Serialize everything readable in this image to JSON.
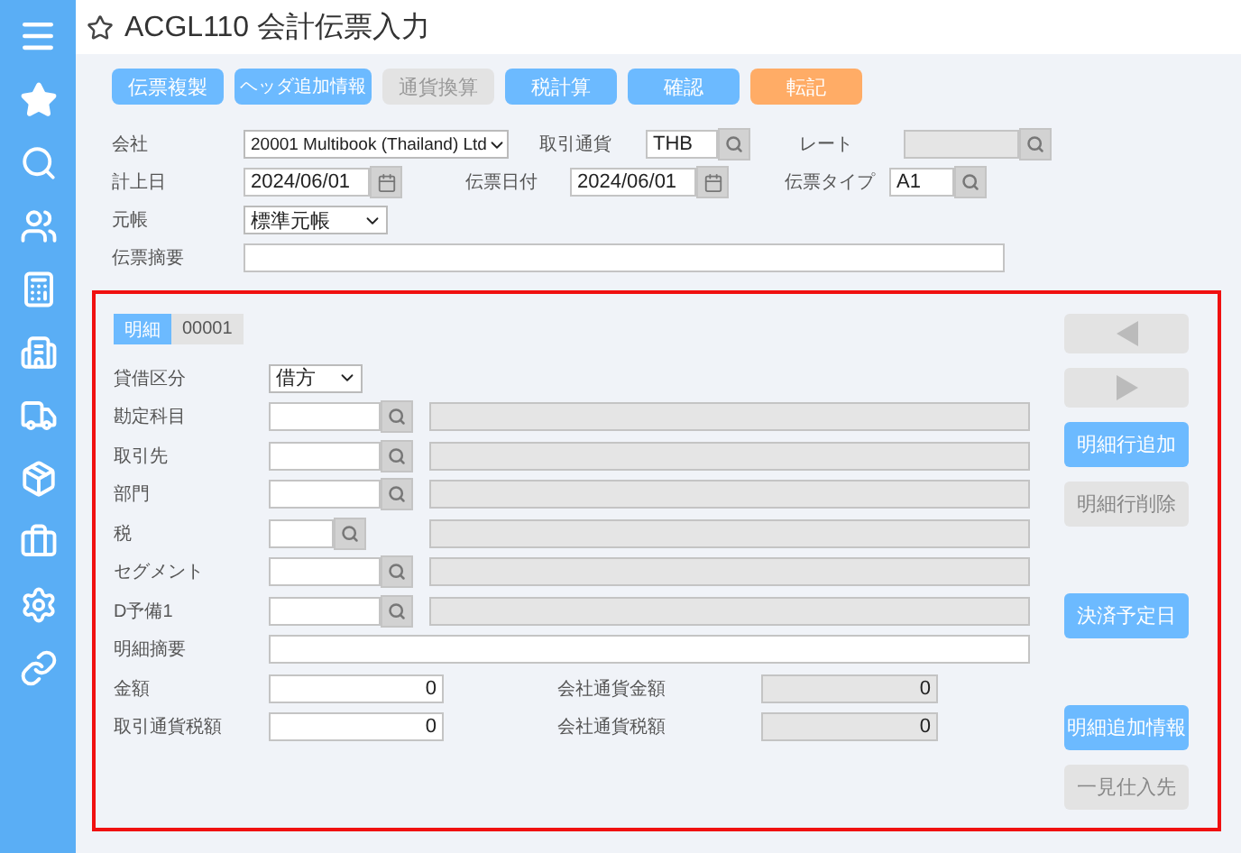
{
  "title": "ACGL110 会計伝票入力",
  "toolbar": [
    {
      "label": "伝票複製",
      "kind": "primary"
    },
    {
      "label": "ヘッダ追加情報",
      "kind": "primary"
    },
    {
      "label": "通貨換算",
      "kind": "disabled"
    },
    {
      "label": "税計算",
      "kind": "primary"
    },
    {
      "label": "確認",
      "kind": "primary"
    },
    {
      "label": "転記",
      "kind": "warning"
    }
  ],
  "header": {
    "company": {
      "label": "会社",
      "value": "20001 Multibook (Thailand) Ltd"
    },
    "currency": {
      "label": "取引通貨",
      "value": "THB"
    },
    "rate": {
      "label": "レート",
      "disabled": true
    },
    "posting_date": {
      "label": "計上日",
      "value": "2024/06/01"
    },
    "voucher_date": {
      "label": "伝票日付",
      "value": "2024/06/01"
    },
    "voucher_type": {
      "label": "伝票タイプ",
      "value": "A1"
    },
    "ledger": {
      "label": "元帳",
      "value": "標準元帳"
    },
    "summary": {
      "label": "伝票摘要"
    }
  },
  "detail": {
    "tabs": [
      {
        "label": "明細",
        "selected": true
      },
      {
        "label": "00001",
        "selected": false
      }
    ],
    "fields": [
      {
        "kind": "select",
        "label": "貸借区分",
        "value": "借方"
      },
      {
        "kind": "lookup",
        "label": "勘定科目"
      },
      {
        "kind": "lookup",
        "label": "取引先"
      },
      {
        "kind": "lookup",
        "label": "部門"
      },
      {
        "kind": "lookup_short",
        "label": "税"
      },
      {
        "kind": "lookup",
        "label": "セグメント"
      },
      {
        "kind": "lookup",
        "label": "D予備1"
      },
      {
        "kind": "text",
        "label": "明細摘要"
      },
      {
        "kind": "amount",
        "label": "金額",
        "value": "0",
        "company_label": "会社通貨金額",
        "company_value": "0"
      },
      {
        "kind": "amount",
        "label": "取引通貨税額",
        "value": "0",
        "company_label": "会社通貨税額",
        "company_value": "0"
      }
    ],
    "side_buttons": [
      [
        {
          "kind": "prev",
          "disabled": true
        },
        {
          "kind": "next",
          "disabled": true
        },
        {
          "kind": "button",
          "label": "明細行追加",
          "disabled": false
        },
        {
          "kind": "button",
          "label": "明細行削除",
          "disabled": true
        }
      ],
      [
        {
          "kind": "button",
          "label": "決済予定日",
          "disabled": false
        }
      ],
      [
        {
          "kind": "button",
          "label": "明細追加情報",
          "disabled": false
        },
        {
          "kind": "button",
          "label": "一見仕入先",
          "disabled": true
        }
      ]
    ]
  }
}
